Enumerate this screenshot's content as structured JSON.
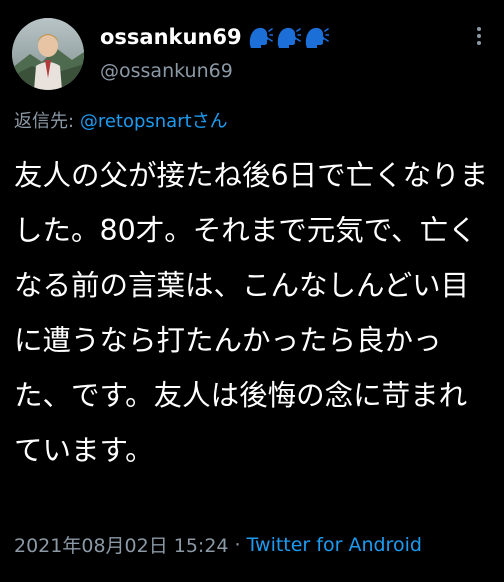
{
  "user": {
    "display_name": "ossankun69",
    "handle": "@ossankun69",
    "emoji_count": 3,
    "emoji_icon": "speaking-head-icon",
    "emoji_color": "#1d6fd8"
  },
  "reply": {
    "label": "返信先:",
    "to": "@retopsnartさん"
  },
  "tweet": {
    "text": "友人の父が接たね後6日で亡くなりました。80才。それまで元気で、亡くなる前の言葉は、こんなしんどい目に遭うなら打たんかったら良かった、です。友人は後悔の念に苛まれています。"
  },
  "meta": {
    "timestamp": "2021年08月02日 15:24",
    "separator": "·",
    "source": "Twitter for Android"
  },
  "colors": {
    "background": "#000000",
    "text": "#ffffff",
    "muted": "#8b98a5",
    "link": "#1d9bf0"
  },
  "icons": {
    "more": "more-vertical-icon"
  }
}
